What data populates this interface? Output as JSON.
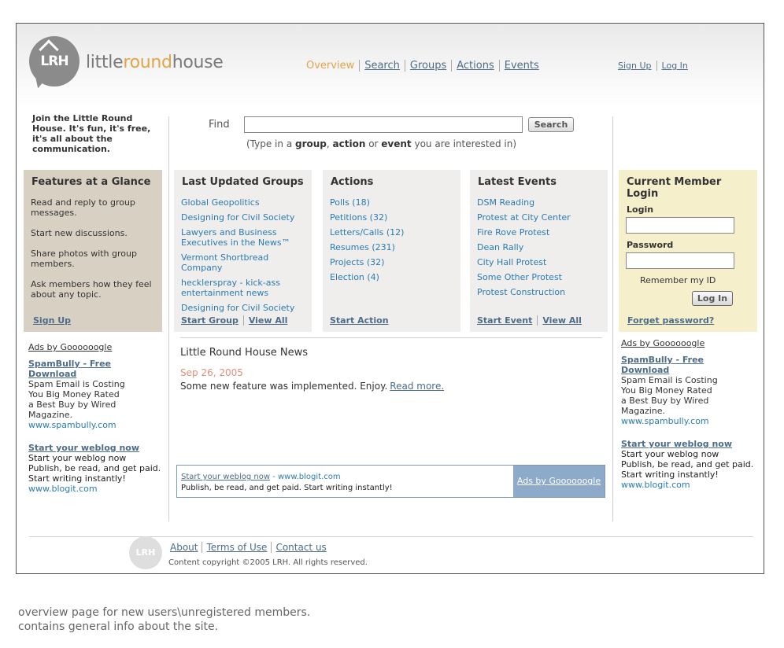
{
  "header": {
    "logo_letters": "LRH",
    "brand": {
      "part1": "little",
      "part2": "round",
      "part3": "house"
    },
    "nav": [
      {
        "label": "Overview",
        "active": true
      },
      {
        "label": "Search"
      },
      {
        "label": "Groups"
      },
      {
        "label": "Actions"
      },
      {
        "label": "Events"
      }
    ],
    "user_nav": [
      {
        "label": "Sign Up"
      },
      {
        "label": "Log In"
      }
    ]
  },
  "intro": {
    "join_text": "Join the Little Round House. It's fun, it's free, it's all about the communication."
  },
  "find": {
    "label": "Find",
    "input_value": "",
    "button": "Search",
    "hint_prefix": "(Type in a ",
    "hint_group": "group",
    "hint_comma": ", ",
    "hint_action": "action",
    "hint_or": " or ",
    "hint_event": "event",
    "hint_suffix": " you are interested in)"
  },
  "features": {
    "title": "Features at a Glance",
    "items": [
      "Read and reply to group messages.",
      "Start new discussions.",
      "Share photos with group members.",
      "Ask members how they feel about any topic."
    ],
    "signup": "Sign Up"
  },
  "groups": {
    "title": "Last Updated Groups",
    "items": [
      "Global Geopolitics",
      "Designing for Civil Society",
      "Lawyers and Business Executives in the News™",
      "Vermont Shortbread Company",
      "hecklerspray - kick-ass entertainment news",
      "Designing for Civil Society"
    ],
    "start": "Start Group",
    "view_all": "View All"
  },
  "actions": {
    "title": "Actions",
    "items": [
      "Polls (18)",
      "Petitions (32)",
      "Letters/Calls (12)",
      "Resumes (231)",
      "Projects (32)",
      "Election (4)"
    ],
    "start": "Start Action"
  },
  "events": {
    "title": "Latest Events",
    "items": [
      "DSM Reading",
      "Protest at City Center",
      "Fire Rove Protest",
      "Dean Rally",
      "City Hall Protest",
      "Some Other Protest",
      "Protest Construction"
    ],
    "start": "Start Event",
    "view_all": "View All"
  },
  "login": {
    "title": "Current Member Login",
    "login_label": "Login",
    "login_value": "",
    "password_label": "Password",
    "password_value": "",
    "remember": "Remember my ID",
    "button": "Log In",
    "forgot": "Forget password?"
  },
  "ads_left": {
    "ads_by": "Ads by Goooooogle",
    "ad1_title": "SpamBully - Free Download",
    "ad1_text": "Spam Email is Costing You Big Money Rated a Best Buy by Wired Magazine.",
    "ad1_url": "www.spambully.com",
    "ad2_title": "Start your weblog now",
    "ad2_text": "Start your weblog now Publish, be read, and get paid. Start writing instantly!",
    "ad2_url": "www.blogit.com"
  },
  "ads_right": {
    "ads_by": "Ads by Goooooogle",
    "ad1_title": "SpamBully - Free Download",
    "ad1_text": "Spam Email is Costing You Big Money Rated a Best Buy by Wired Magazine.",
    "ad1_url": "www.spambully.com",
    "ad2_title": "Start your weblog now",
    "ad2_text": "Start your weblog now Publish, be read, and get paid. Start writing instantly!",
    "ad2_url": "www.blogit.com"
  },
  "news": {
    "title": "Little Round House News",
    "date": "Sep 26, 2005",
    "text": "Some new feature was implemented. Enjoy.",
    "read_more": "Read more."
  },
  "adbar": {
    "title": "Start your weblog now",
    "sep": " - ",
    "domain": "www.blogit.com",
    "text": "Publish, be read, and get paid. Start writing instantly!",
    "ads_by": "Ads by Goooooogle"
  },
  "footer": {
    "logo_letters": "LRH",
    "links": [
      "About",
      "Terms of Use",
      "Contact us"
    ],
    "copyright": "Content copyright ©2005 LRH. All rights reserved."
  },
  "caption": {
    "line1": "overview page for new users\\unregistered members.",
    "line2": "contains general info about the site."
  }
}
